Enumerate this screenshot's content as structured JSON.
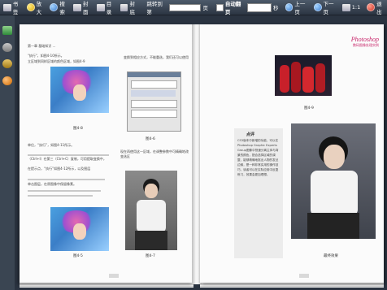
{
  "toolbar": {
    "tab_label": "书签",
    "zoom_in": "放大",
    "search": "搜索",
    "cover": "封面",
    "toc": "目录",
    "back_cover": "封底",
    "jump_label": "跳转到第",
    "jump_suffix": "页",
    "auto_flip": "自动翻页",
    "seconds": "秒",
    "prev": "上一页",
    "next": "下一页",
    "ratio": "1:1",
    "exit": "退出"
  },
  "left_page": {
    "header": "第一章 基础知识 …",
    "intro": "\"执行\"，如图4-10所示。",
    "intro2": "立区域到同样区域的颜色区域，如图4-9",
    "fig1_caption": "图4-8",
    "fig2_caption": "图4-5",
    "fig3_caption": "图4-6",
    "fig4_caption": "图4-7",
    "right_col_top": "变换到相应方式，不能重选，我们还可以使用快捷套",
    "mid_left": "单位，“执行”，如图4-11所示。",
    "mid_right": "现在再使用这一区域，在调整参数中可精确地改变选区",
    "body1": "（Ctrl+I）在第三（Ctrl+C）复制，可用提取变换中，",
    "body2": "在提示点，“执行”如图4-12所示，以及图层",
    "body3": "单击图层，在原图像中保留像素。"
  },
  "right_page": {
    "logo_title": "Photoshop",
    "logo_sub": "数码图像处理实例",
    "fig_caption": "图4-9",
    "sidebar_title": "点评",
    "sidebar_text": "CS3版本中新增的功能，可以在Photoshop Graphic Experts Group图像中快速分离主体与背景的颜色，配合选择区域的调整，能够精确地抠出人物的发丝边缘，是一种非常实用的操作技巧，读者可以在实际应用中反复练习，效果会更加理想。",
    "photo_caption": "最终效果"
  },
  "colors": {
    "toolbar_top": "#4d5a6a",
    "page_bg": "#fbfbfb",
    "logo_pink": "#c8266a"
  }
}
